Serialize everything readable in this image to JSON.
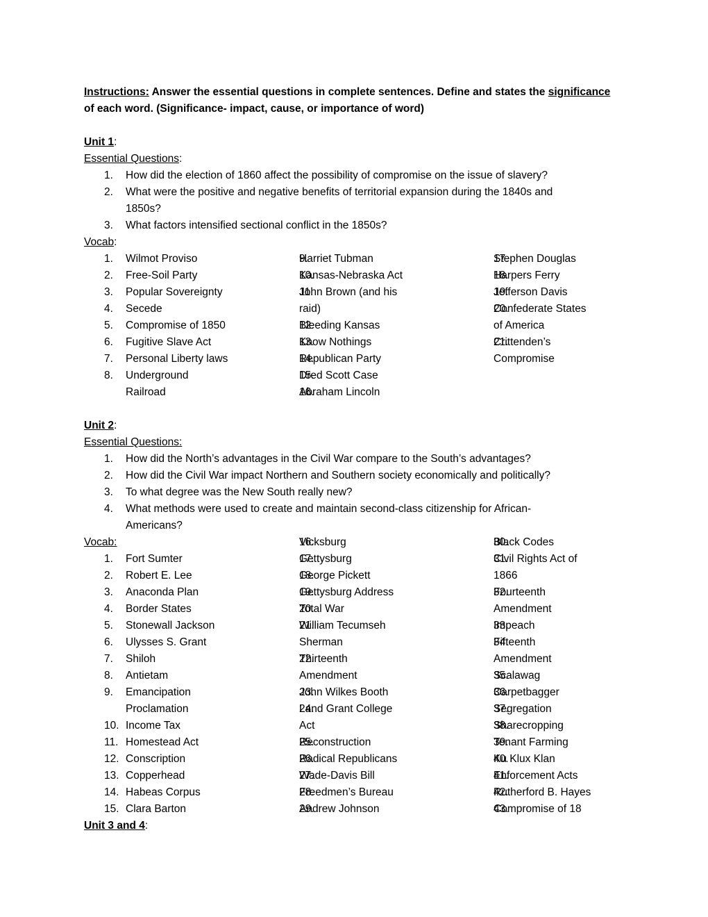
{
  "instructions": {
    "label": "Instructions:",
    "text_a": " Answer the essential questions in complete sentences. Define and states the ",
    "significance_word": "significance",
    "text_b": "of each word. (Significance- impact, cause, or importance of word)"
  },
  "unit1": {
    "title": "Unit 1",
    "colon": ":",
    "eq_label": "Essential Questions",
    "eq_colon": ":",
    "questions": [
      {
        "num": "1.",
        "text": "How did the election of 1860 affect the possibility of compromise on the issue of slavery?"
      },
      {
        "num": "2.",
        "text": "What were the positive and negative benefits of territorial expansion during the 1840s and"
      },
      {
        "num": "",
        "text": "1850s?"
      },
      {
        "num": "3.",
        "text": "What factors intensified sectional conflict in the 1850s?"
      }
    ],
    "vocab_label": "Vocab",
    "vocab_colon": ":",
    "vocab_col1": [
      {
        "num": "1.",
        "text": "Wilmot Proviso"
      },
      {
        "num": "2.",
        "text": "Free-Soil Party"
      },
      {
        "num": "3.",
        "text": "Popular Sovereignty"
      },
      {
        "num": "4.",
        "text": "Secede"
      },
      {
        "num": "5.",
        "text": "Compromise of 1850"
      },
      {
        "num": "6.",
        "text": "Fugitive Slave Act"
      },
      {
        "num": "7.",
        "text": "Personal Liberty laws"
      },
      {
        "num": "8.",
        "text": "Underground"
      },
      {
        "num": "",
        "text": "Railroad"
      }
    ],
    "vocab_col2": [
      {
        "num": "9.",
        "text": "Harriet Tubman"
      },
      {
        "num": "10.",
        "text": "Kansas-Nebraska Act"
      },
      {
        "num": "11.",
        "text": "John Brown (and his"
      },
      {
        "num": "",
        "text": "raid)"
      },
      {
        "num": "12.",
        "text": "Bleeding Kansas"
      },
      {
        "num": "13.",
        "text": "Know Nothings"
      },
      {
        "num": "14.",
        "text": "Republican Party"
      },
      {
        "num": "15.",
        "text": "Dred Scott Case"
      },
      {
        "num": "16.",
        "text": "Abraham Lincoln"
      }
    ],
    "vocab_col3": [
      {
        "num": "17.",
        "text": "Stephen Douglas"
      },
      {
        "num": "18.",
        "text": "Harpers Ferry"
      },
      {
        "num": "19.",
        "text": "Jefferson Davis"
      },
      {
        "num": "20.",
        "text": "Confederate States"
      },
      {
        "num": "",
        "text": "of America"
      },
      {
        "num": "21.",
        "text": "Crittenden’s"
      },
      {
        "num": "",
        "text": "Compromise"
      }
    ]
  },
  "unit2": {
    "title": "Unit 2",
    "colon": ":",
    "eq_label": "Essential Questions:",
    "questions": [
      {
        "num": "1.",
        "text": "How did the North’s advantages in the Civil War compare to the South’s advantages?"
      },
      {
        "num": "2.",
        "text": "How did the Civil War impact Northern and Southern society economically and politically?"
      },
      {
        "num": "3.",
        "text": "To what degree was the New South really new?"
      },
      {
        "num": "4.",
        "text": "What methods were used to create and maintain second-class citizenship for African-"
      },
      {
        "num": "",
        "text": "Americans?"
      }
    ],
    "vocab_label": "Vocab:",
    "vocab_col1": [
      {
        "num": "1.",
        "text": "Fort Sumter"
      },
      {
        "num": "2.",
        "text": "Robert E. Lee"
      },
      {
        "num": "3.",
        "text": "Anaconda Plan"
      },
      {
        "num": "4.",
        "text": "Border States"
      },
      {
        "num": "5.",
        "text": "Stonewall Jackson"
      },
      {
        "num": "6.",
        "text": "Ulysses S. Grant"
      },
      {
        "num": "7.",
        "text": "Shiloh"
      },
      {
        "num": "8.",
        "text": "Antietam"
      },
      {
        "num": "9.",
        "text": "Emancipation"
      },
      {
        "num": "",
        "text": "Proclamation"
      },
      {
        "num": "10.",
        "text": "Income Tax"
      },
      {
        "num": "11.",
        "text": "Homestead Act"
      },
      {
        "num": "12.",
        "text": "Conscription"
      },
      {
        "num": "13.",
        "text": "Copperhead"
      },
      {
        "num": "14.",
        "text": "Habeas Corpus"
      },
      {
        "num": "15.",
        "text": "Clara Barton"
      }
    ],
    "vocab_col2": [
      {
        "num": "16.",
        "text": "Vicksburg"
      },
      {
        "num": "17.",
        "text": "Gettysburg"
      },
      {
        "num": "18.",
        "text": "George Pickett"
      },
      {
        "num": "19.",
        "text": "Gettysburg Address"
      },
      {
        "num": "20.",
        "text": "Total War"
      },
      {
        "num": "21.",
        "text": "William Tecumseh"
      },
      {
        "num": "",
        "text": "Sherman"
      },
      {
        "num": "22.",
        "text": "Thirteenth"
      },
      {
        "num": "",
        "text": "Amendment"
      },
      {
        "num": "23.",
        "text": "John Wilkes Booth"
      },
      {
        "num": "24.",
        "text": "Land Grant College"
      },
      {
        "num": "",
        "text": "Act"
      },
      {
        "num": "25.",
        "text": "Reconstruction"
      },
      {
        "num": "26.",
        "text": "Radical Republicans"
      },
      {
        "num": "27.",
        "text": "Wade-Davis Bill"
      },
      {
        "num": "28.",
        "text": "Freedmen’s Bureau"
      },
      {
        "num": "29.",
        "text": "Andrew Johnson"
      }
    ],
    "vocab_col3": [
      {
        "num": "30.",
        "text": "Black Codes"
      },
      {
        "num": "31.",
        "text": "Civil Rights Act of"
      },
      {
        "num": "",
        "text": "1866"
      },
      {
        "num": "32.",
        "text": "Fourteenth"
      },
      {
        "num": "",
        "text": "Amendment"
      },
      {
        "num": "33.",
        "text": "Impeach"
      },
      {
        "num": "34.",
        "text": "Fifteenth"
      },
      {
        "num": "",
        "text": "Amendment"
      },
      {
        "num": "35.",
        "text": "Scalawag"
      },
      {
        "num": "36.",
        "text": "Carpetbagger"
      },
      {
        "num": "37.",
        "text": "Segregation"
      },
      {
        "num": "38.",
        "text": "Sharecropping"
      },
      {
        "num": "39.",
        "text": "Tenant Farming"
      },
      {
        "num": "40.",
        "text": "Ku Klux Klan"
      },
      {
        "num": "41.",
        "text": "Enforcement Acts"
      },
      {
        "num": "42.",
        "text": "Rutherford B. Hayes"
      },
      {
        "num": "43.",
        "text": "Compromise of 18"
      }
    ]
  },
  "unit34": {
    "title": "Unit 3 and 4",
    "colon": ":"
  }
}
